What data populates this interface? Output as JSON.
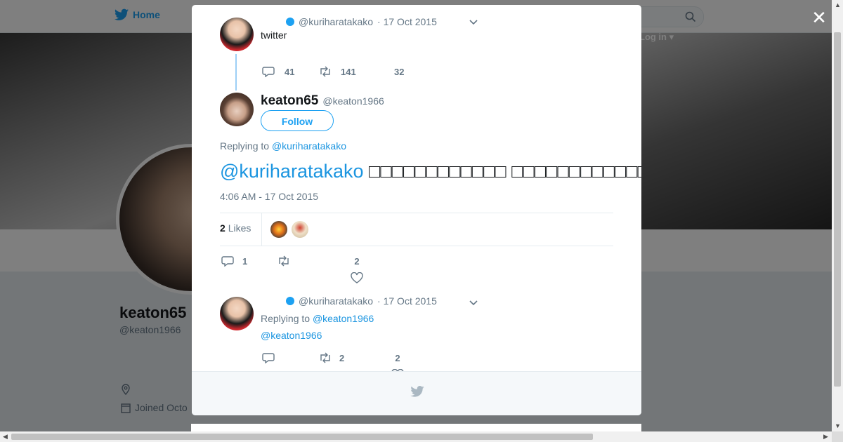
{
  "nav": {
    "home_label": "Home",
    "login_label": "Log in"
  },
  "profile": {
    "name": "keaton65",
    "handle": "@keaton1966",
    "joined": "Joined Octo"
  },
  "modal": {
    "parent_tweet": {
      "handle": "@kuriharatakako",
      "date": "· 17 Oct 2015",
      "text": "twitter",
      "replies": "41",
      "retweets": "141",
      "likes": "32"
    },
    "main_tweet": {
      "name": "keaton65",
      "handle": "@keaton1966",
      "follow_label": "Follow",
      "replying_prefix": "Replying to",
      "replying_to": "@kuriharatakako",
      "mention": "@kuriharatakako",
      "text": "□□□□□□□□□□□□ □□□□□□□□□□□□□□□□□□□□□□□□□□□□□",
      "timestamp": "4:06 AM - 17 Oct 2015",
      "likes_count": "2",
      "likes_label": "Likes",
      "replies": "1",
      "likes": "2"
    },
    "reply_tweet": {
      "handle": "@kuriharatakako",
      "date": "· 17 Oct 2015",
      "replying_prefix": "Replying to",
      "replying_to": "@keaton1966",
      "text": "@keaton1966",
      "retweets": "2",
      "likes": "2"
    }
  },
  "icons": {
    "close": "close-icon",
    "brand": "bird-icon"
  }
}
